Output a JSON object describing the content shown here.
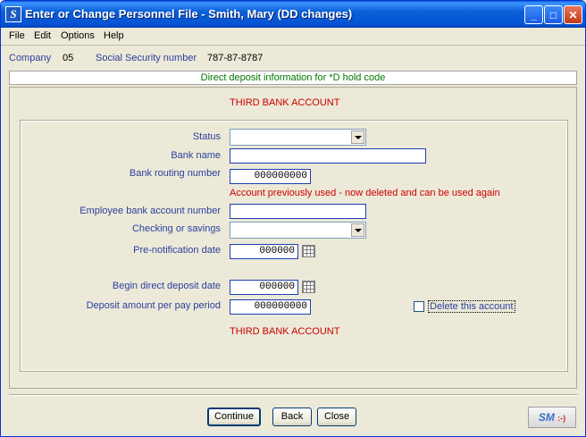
{
  "window": {
    "title": "Enter or Change Personnel File - Smith, Mary  (DD changes)",
    "app_icon_letter": "S",
    "minimize_glyph": "_",
    "maximize_glyph": "□",
    "close_glyph": "✕"
  },
  "menu": {
    "file": "File",
    "edit": "Edit",
    "options": "Options",
    "help": "Help"
  },
  "info": {
    "company_label": "Company",
    "company_value": "05",
    "ssn_label": "Social Security number",
    "ssn_value": "787-87-8787"
  },
  "banner": "Direct deposit information for  *D  hold code",
  "section_title_top": "THIRD BANK ACCOUNT",
  "section_title_bottom": "THIRD BANK ACCOUNT",
  "form": {
    "status_label": "Status",
    "status_value": "",
    "bank_name_label": "Bank name",
    "bank_name_value": "",
    "routing_label": "Bank routing number",
    "routing_value": "000000000",
    "routing_warning": "Account previously used - now deleted and can be used again",
    "account_label": "Employee bank account number",
    "account_value": "",
    "checking_label": "Checking or savings",
    "checking_value": "",
    "prenote_label": "Pre-notification date",
    "prenote_value": "000000",
    "begin_label": "Begin direct deposit date",
    "begin_value": "000000",
    "amount_label": "Deposit amount per pay period",
    "amount_value": "000000000",
    "delete_label": "Delete this account",
    "delete_checked": false
  },
  "buttons": {
    "continue": "Continue",
    "back": "Back",
    "close": "Close"
  },
  "logo": {
    "text": "SM",
    "smile": ":-)"
  }
}
